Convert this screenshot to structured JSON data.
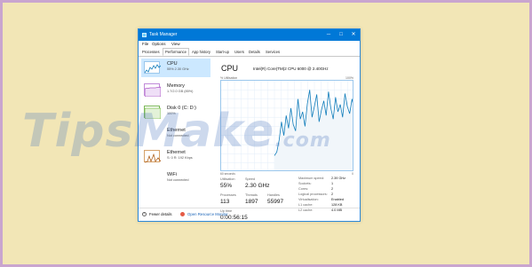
{
  "window": {
    "title": "Task Manager",
    "controls": {
      "minimize": "─",
      "maximize": "□",
      "close": "✕"
    }
  },
  "menu": {
    "items": [
      "File",
      "Options",
      "View"
    ]
  },
  "tabs": [
    "Processes",
    "Performance",
    "App history",
    "Start-up",
    "Users",
    "Details",
    "Services"
  ],
  "active_tab": "Performance",
  "sidebar": {
    "items": [
      {
        "name": "CPU",
        "sub": "55%  2.30 GHz",
        "selected": true,
        "graph": "cpu"
      },
      {
        "name": "Memory",
        "sub": "1.7/2.0 GB (85%)",
        "selected": false,
        "graph": "memory"
      },
      {
        "name": "Disk 0 (C: D:)",
        "sub": "100%",
        "selected": false,
        "graph": "disk"
      },
      {
        "name": "Ethernet",
        "sub": "Not connected",
        "selected": false,
        "graph": "none"
      },
      {
        "name": "Ethernet",
        "sub": "S: 0  R: 192 Kbps",
        "selected": false,
        "graph": "eth"
      },
      {
        "name": "WiFi",
        "sub": "Not connected",
        "selected": false,
        "graph": "none"
      }
    ]
  },
  "main": {
    "title": "CPU",
    "model": "Intel(R) Core(TM)2 CPU 6000 @ 2.40GHz",
    "util_label": "% Utilisation",
    "util_max": "100%",
    "time_label": "60 seconds",
    "time_min": "0",
    "stats": {
      "utilisation": {
        "label": "Utilisation",
        "value": "55%"
      },
      "speed": {
        "label": "Speed",
        "value": "2.30 GHz"
      },
      "processes": {
        "label": "Processes",
        "value": "113"
      },
      "threads": {
        "label": "Threads",
        "value": "1897"
      },
      "handles": {
        "label": "Handles",
        "value": "55997"
      },
      "uptime": {
        "label": "Up time",
        "value": "0:00:56:15"
      }
    },
    "details": [
      {
        "label": "Maximum speed:",
        "value": "2.39 GHz"
      },
      {
        "label": "Sockets:",
        "value": "1"
      },
      {
        "label": "Cores:",
        "value": "2"
      },
      {
        "label": "Logical processors:",
        "value": "2"
      },
      {
        "label": "Virtualisation:",
        "value": "Enabled"
      },
      {
        "label": "L1 cache:",
        "value": "128 KB"
      },
      {
        "label": "L2 cache:",
        "value": "4.0 MB"
      }
    ]
  },
  "cpu_history": [
    18,
    22,
    35,
    55,
    40,
    62,
    48,
    70,
    52,
    45,
    80,
    58,
    66,
    50,
    75,
    90,
    60,
    72,
    85,
    55,
    68,
    78,
    62,
    88,
    70,
    58,
    82,
    66,
    74,
    60,
    86,
    72,
    64,
    80,
    68
  ],
  "footer": {
    "fewer_details": "Fewer details",
    "open_monitor": "Open Resource Monitor"
  },
  "watermark": {
    "text": "TipsMake",
    "suffix": ".com"
  },
  "colors": {
    "accent": "#0078d7",
    "graph_line": "#117dbb",
    "selected_bg": "#cce8ff",
    "page_bg": "#f2e6b6"
  }
}
